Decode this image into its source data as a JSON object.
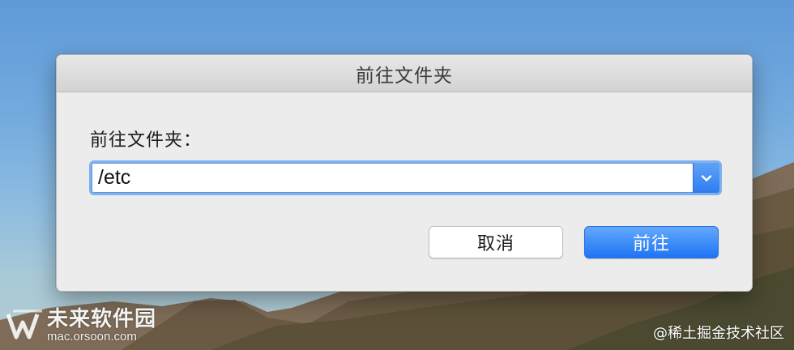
{
  "dialog": {
    "title": "前往文件夹",
    "prompt_label": "前往文件夹：",
    "path_field": {
      "value": "/etc",
      "dropdown_icon": "chevron-down-icon"
    },
    "buttons": {
      "cancel_label": "取消",
      "go_label": "前往"
    }
  },
  "watermarks": {
    "site_name": "未来软件园",
    "site_url": "mac.orsoon.com",
    "community": "@稀土掘金技术社区"
  },
  "colors": {
    "accent": "#2f7cf0",
    "focus_ring": "#7fb1ee",
    "dialog_bg": "#ececec"
  }
}
